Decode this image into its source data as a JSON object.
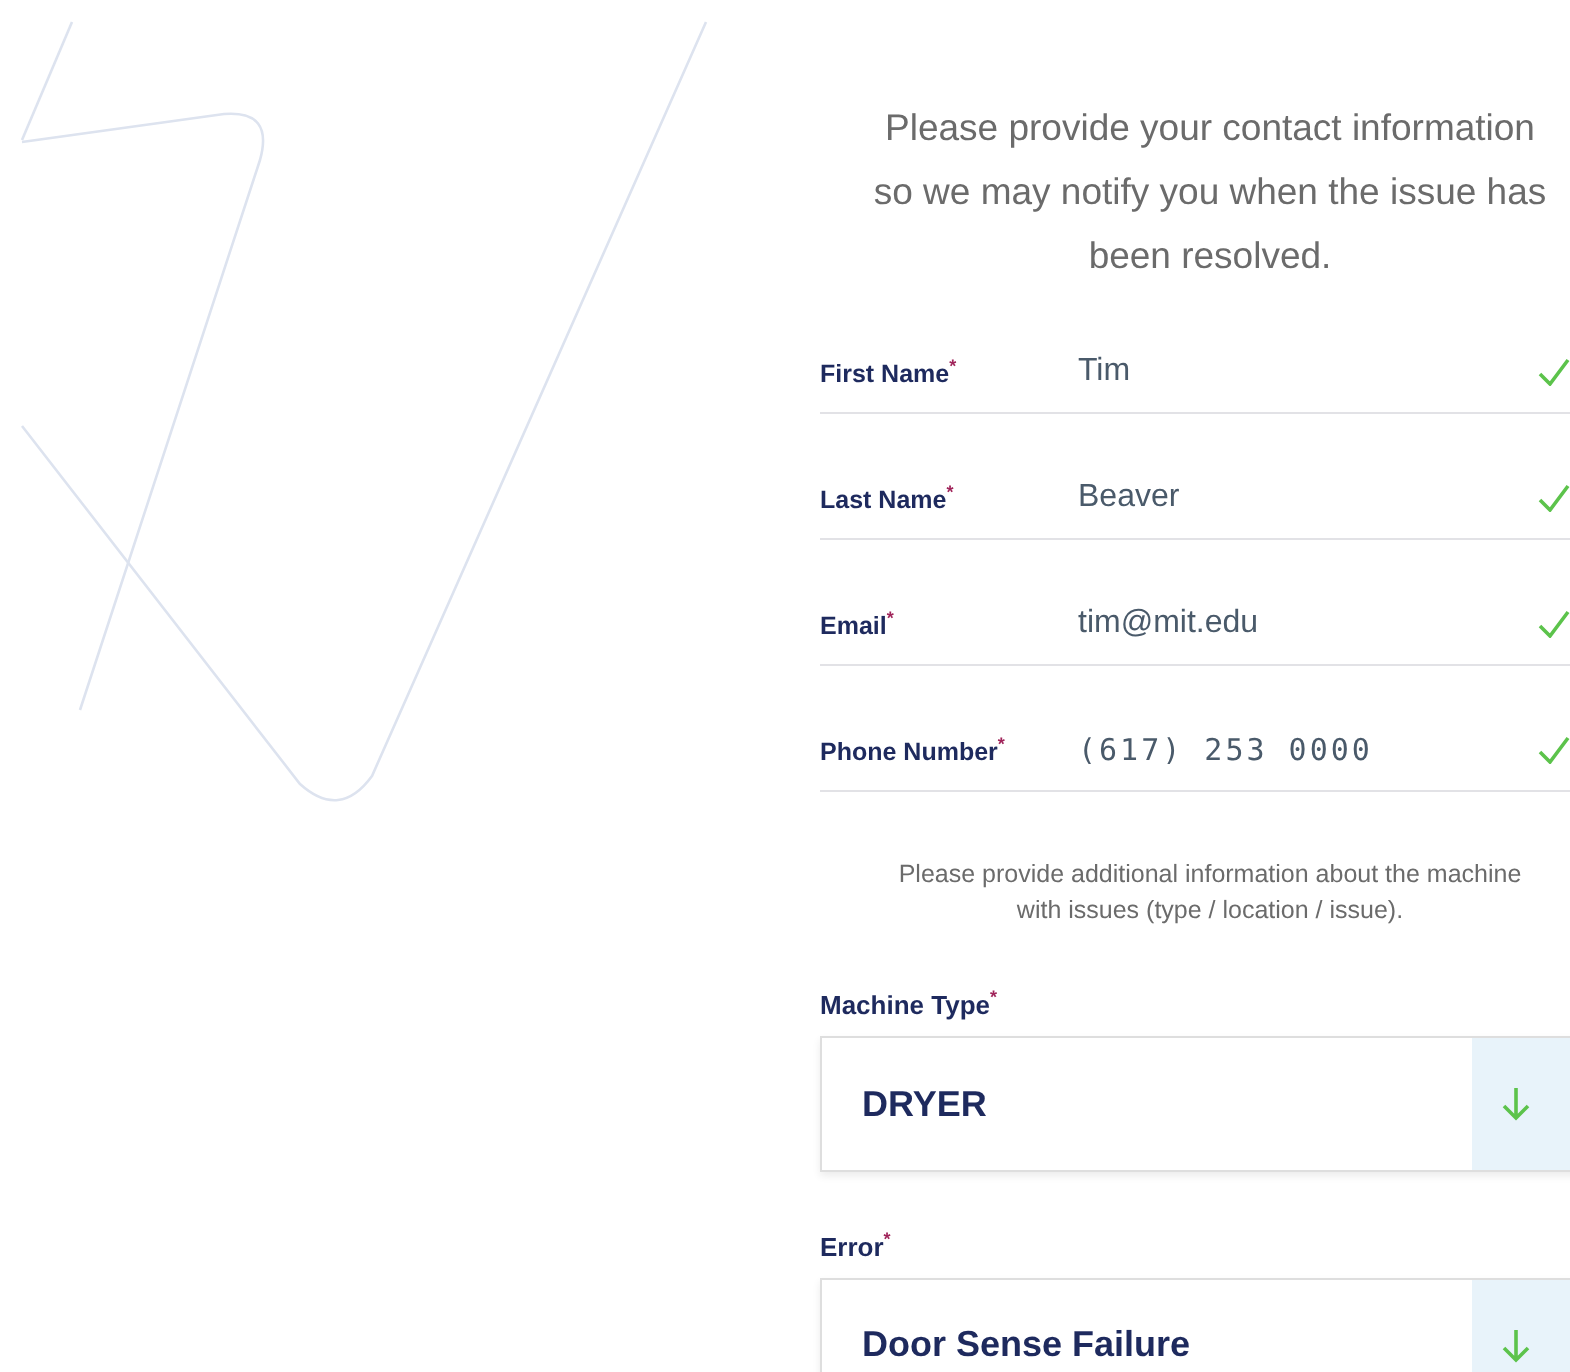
{
  "intro": "Please provide your contact information so we may notify you when the issue has been resolved.",
  "fields": [
    {
      "label": "First Name$^{*}$",
      "value": "Tim",
      "valid": true,
      "kind": "text"
    },
    {
      "label": "Last Name$^{*}$",
      "value": "Beaver",
      "valid": true,
      "kind": "text"
    },
    {
      "label": "Email$^{*}$",
      "value": "tim@mit.edu",
      "valid": true,
      "kind": "text"
    },
    {
      "label": "Phone Number$^{*}$",
      "value": "(617) 253 0000",
      "valid": true,
      "kind": "phone"
    }
  ],
  "machine_note": "Please provide additional information about the machine with issues (type / location / issue).",
  "selects": [
    {
      "label": "Machine Type$^{*}$",
      "value": "DRYER"
    },
    {
      "label": "Error$^{*}$",
      "value": "Door Sense Failure"
    }
  ]
}
